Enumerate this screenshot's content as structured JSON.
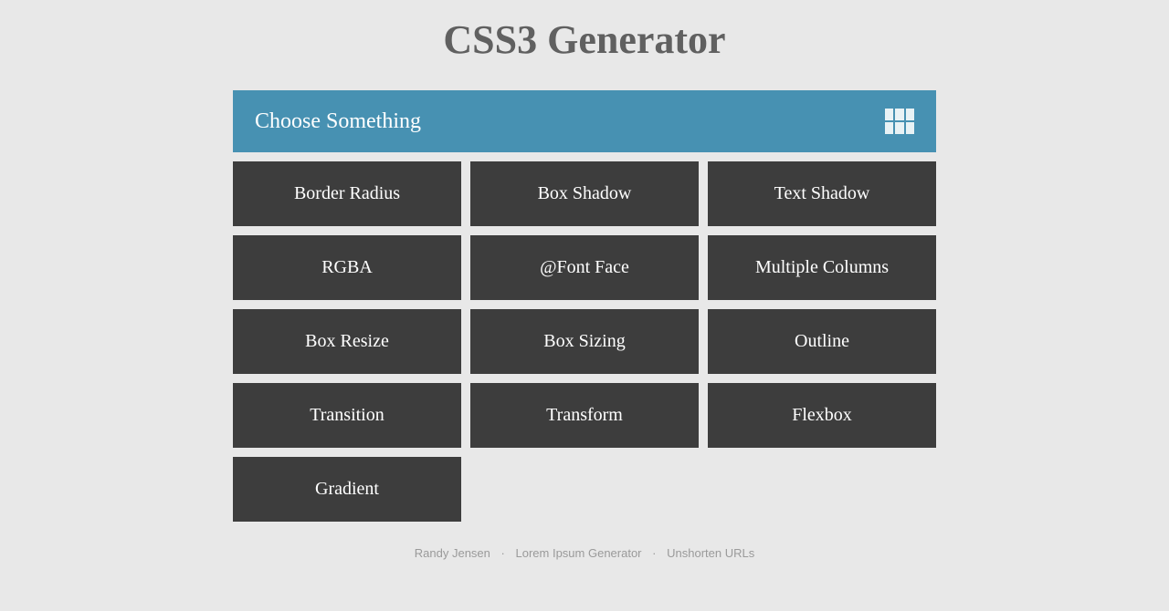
{
  "page_title": "CSS3 Generator",
  "header": {
    "label": "Choose Something"
  },
  "options": [
    {
      "label": "Border Radius"
    },
    {
      "label": "Box Shadow"
    },
    {
      "label": "Text Shadow"
    },
    {
      "label": "RGBA"
    },
    {
      "label": "@Font Face"
    },
    {
      "label": "Multiple Columns"
    },
    {
      "label": "Box Resize"
    },
    {
      "label": "Box Sizing"
    },
    {
      "label": "Outline"
    },
    {
      "label": "Transition"
    },
    {
      "label": "Transform"
    },
    {
      "label": "Flexbox"
    },
    {
      "label": "Gradient"
    }
  ],
  "footer": {
    "author": "Randy Jensen",
    "link1": "Lorem Ipsum Generator",
    "link2": "Unshorten URLs",
    "sep": "·"
  }
}
